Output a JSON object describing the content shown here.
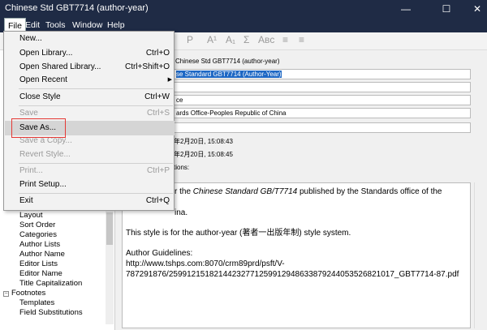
{
  "window": {
    "title": "Chinese Std GBT7714 (author-year)"
  },
  "menubar": {
    "items": [
      "File",
      "Edit",
      "Tools",
      "Window",
      "Help"
    ]
  },
  "toolbar": {
    "buttons": [
      "P",
      "A¹",
      "A₁",
      "Σ",
      "Aʙᴄ"
    ]
  },
  "file_menu": {
    "items": [
      {
        "label": "New...",
        "shortcut": "",
        "disabled": false
      },
      {
        "label": "Open Library...",
        "shortcut": "Ctrl+O",
        "disabled": false
      },
      {
        "label": "Open Shared Library...",
        "shortcut": "Ctrl+Shift+O",
        "disabled": false
      },
      {
        "label": "Open Recent",
        "shortcut": "",
        "disabled": false,
        "submenu": true
      },
      {
        "label": "Close Style",
        "shortcut": "Ctrl+W",
        "disabled": false
      },
      {
        "label": "Save",
        "shortcut": "Ctrl+S",
        "disabled": true
      },
      {
        "label": "Save As...",
        "shortcut": "",
        "disabled": false,
        "hover": true
      },
      {
        "label": "Save a Copy...",
        "shortcut": "",
        "disabled": true
      },
      {
        "label": "Revert Style...",
        "shortcut": "",
        "disabled": true
      },
      {
        "label": "Print...",
        "shortcut": "Ctrl+P",
        "disabled": true
      },
      {
        "label": "Print Setup...",
        "shortcut": "",
        "disabled": false
      },
      {
        "label": "Exit",
        "shortcut": "Ctrl+Q",
        "disabled": false
      }
    ]
  },
  "tree": {
    "items": [
      "Layout",
      "Sort Order",
      "Categories",
      "Author Lists",
      "Author Name",
      "Editor Lists",
      "Editor Name",
      "Title Capitalization",
      "Footnotes",
      "Templates",
      "Field Substitutions"
    ]
  },
  "style_info": {
    "field1": "Chinese Std GBT7714 (author-year)",
    "field2": "se Standard GBT7714 (Author-Year)",
    "field3": "ce",
    "field4": "ards Office-Peoples Republic of China",
    "created_label": "年2月20日, 15:08:43",
    "modified_label": "年2月20日, 15:08:45",
    "comments_label": "tions:",
    "description_line1_pre": "r the ",
    "description_line1_italic": "Chinese Standard GB/T7714",
    "description_line1_post": " published by the Standards office of the Peoples",
    "description_line2": "ina.",
    "description_p2": "This style is for the author-year (著者一出版年制) style system.",
    "guidelines_label": "Author Guidelines:",
    "guidelines_url1": "http://www.tshps.com:8070/crm89prd/psft/V-",
    "guidelines_url2": "787291876/25991215182144232771259912948633879244053526821017_GBT7714-87.pdf"
  }
}
